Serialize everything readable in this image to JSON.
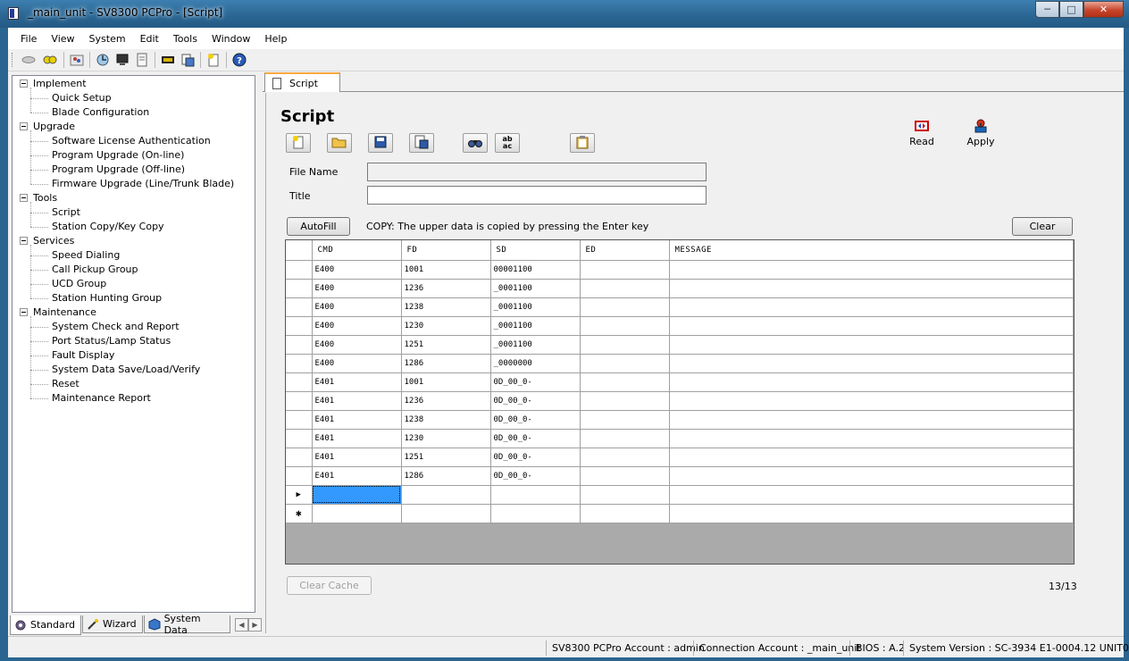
{
  "window": {
    "title": "_main_unit - SV8300 PCPro - [Script]",
    "min": "─",
    "max": "□",
    "close": "✕"
  },
  "menu": [
    "File",
    "View",
    "System",
    "Edit",
    "Tools",
    "Window",
    "Help"
  ],
  "tree": {
    "groups": [
      {
        "label": "Implement",
        "children": [
          "Quick Setup",
          "Blade Configuration"
        ]
      },
      {
        "label": "Upgrade",
        "children": [
          "Software License Authentication",
          "Program Upgrade (On-line)",
          "Program Upgrade (Off-line)",
          "Firmware Upgrade (Line/Trunk Blade)"
        ]
      },
      {
        "label": "Tools",
        "children": [
          "Script",
          "Station Copy/Key Copy"
        ]
      },
      {
        "label": "Services",
        "children": [
          "Speed Dialing",
          "Call Pickup Group",
          "UCD Group",
          "Station Hunting Group"
        ]
      },
      {
        "label": "Maintenance",
        "children": [
          "System Check and Report",
          "Port Status/Lamp Status",
          "Fault Display",
          "System Data Save/Load/Verify",
          "Reset",
          "Maintenance Report"
        ]
      }
    ]
  },
  "left_tabs": [
    "Standard",
    "Wizard",
    "System Data"
  ],
  "doc_tab": "Script",
  "script": {
    "heading": "Script",
    "file_name_label": "File Name",
    "file_name_value": "",
    "title_label": "Title",
    "title_value": "",
    "autofill_label": "AutoFill",
    "copy_note": "COPY: The upper data is copied by pressing the Enter key",
    "clear_label": "Clear",
    "read_label": "Read",
    "apply_label": "Apply",
    "clear_cache_label": "Clear Cache",
    "page_count": "13/13",
    "icon_ab": "ab",
    "icon_ac": "ac"
  },
  "grid": {
    "columns": [
      "CMD",
      "FD",
      "SD",
      "ED",
      "MESSAGE"
    ],
    "rows": [
      [
        "E400",
        "1001",
        "00001100",
        "",
        ""
      ],
      [
        "E400",
        "1236",
        "_0001100",
        "",
        ""
      ],
      [
        "E400",
        "1238",
        "_0001100",
        "",
        ""
      ],
      [
        "E400",
        "1230",
        "_0001100",
        "",
        ""
      ],
      [
        "E400",
        "1251",
        "_0001100",
        "",
        ""
      ],
      [
        "E400",
        "1286",
        "_0000000",
        "",
        ""
      ],
      [
        "E401",
        "1001",
        "0D_00_0-",
        "",
        ""
      ],
      [
        "E401",
        "1236",
        "0D_00_0-",
        "",
        ""
      ],
      [
        "E401",
        "1238",
        "0D_00_0-",
        "",
        ""
      ],
      [
        "E401",
        "1230",
        "0D_00_0-",
        "",
        ""
      ],
      [
        "E401",
        "1251",
        "0D_00_0-",
        "",
        ""
      ],
      [
        "E401",
        "1286",
        "0D_00_0-",
        "",
        ""
      ]
    ],
    "current_row_marker": "▶",
    "new_row_marker": "✱"
  },
  "status": {
    "pcpro_account": "SV8300 PCPro Account : admin",
    "connection_account": "Connection Account : _main_unit",
    "bios": "BIOS : A.2",
    "system_version": "System Version : SC-3934 E1-0004.12 UNIT01"
  },
  "colors": {
    "accent_tab": "#f7a843",
    "selection": "#3399ff",
    "frame": "#2a6592"
  }
}
